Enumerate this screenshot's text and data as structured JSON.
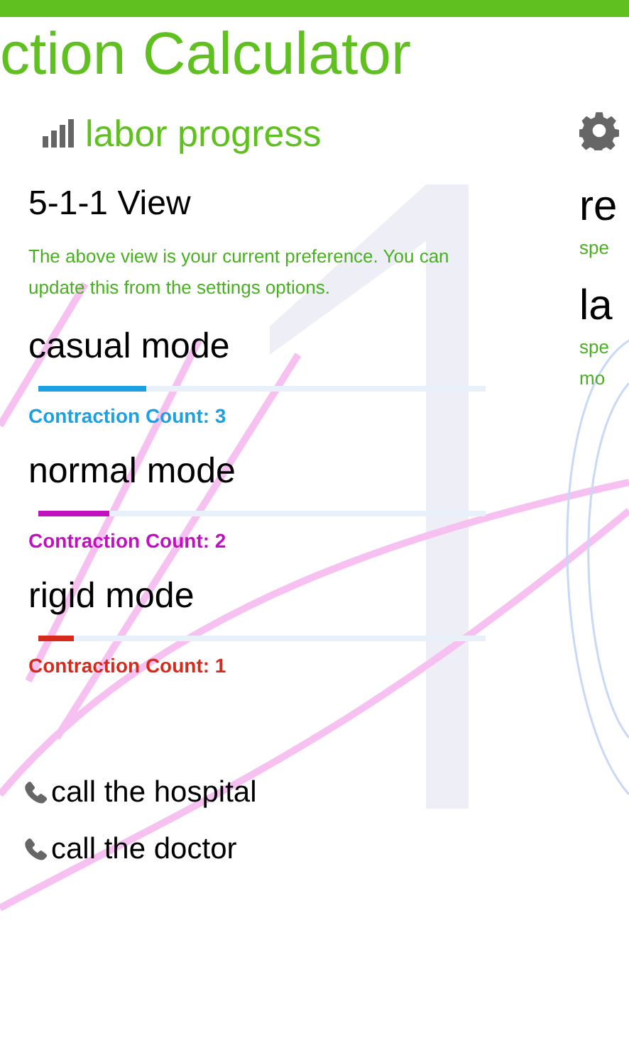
{
  "app_title": "ction Calculator",
  "section": {
    "title": "labor progress",
    "view_name": "5-1-1 View",
    "description": "The above view is your current preference. You can update this from the settings options.",
    "modes": [
      {
        "name": "casual mode",
        "level": 0.24,
        "count": "Contraction Count: 3",
        "color": "#1ba1e2"
      },
      {
        "name": "normal mode",
        "level": 0.16,
        "count": "Contraction Count: 2",
        "color": "#c010c0"
      },
      {
        "name": "rigid mode",
        "level": 0.08,
        "count": "Contraction Count: 1",
        "color": "#d62a1c"
      }
    ],
    "calls": [
      "call the hospital",
      "call the doctor"
    ]
  },
  "next_section": {
    "items": [
      {
        "title": "re",
        "lines": [
          "spe"
        ]
      },
      {
        "title": "la",
        "lines": [
          "spe",
          "mo"
        ]
      }
    ]
  }
}
